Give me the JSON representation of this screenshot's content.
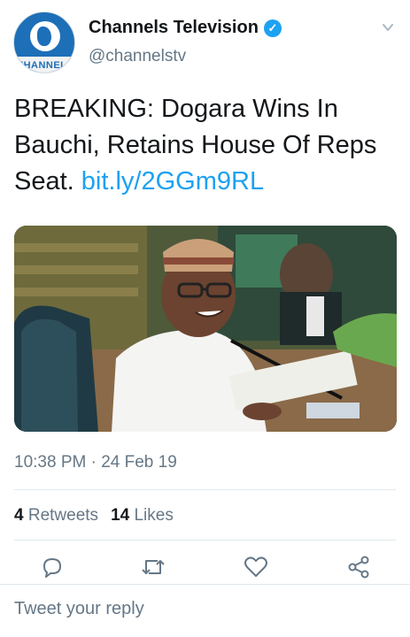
{
  "account": {
    "display_name": "Channels Television",
    "handle": "@channelstv",
    "avatar_text": "'HANNEL'"
  },
  "tweet": {
    "text": "BREAKING: Dogara Wins In Bauchi, Retains House Of Reps Seat.",
    "link": "bit.ly/2GGm9RL",
    "timestamp": "10:38 PM · 24 Feb 19"
  },
  "stats": {
    "retweets_count": "4",
    "retweets_label": "Retweets",
    "likes_count": "14",
    "likes_label": "Likes"
  },
  "reply": {
    "placeholder": "Tweet your reply"
  },
  "colors": {
    "accent": "#1da1f2",
    "muted": "#657786"
  }
}
